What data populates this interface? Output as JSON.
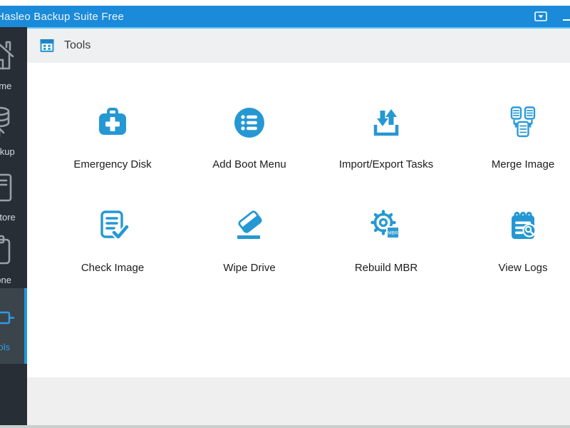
{
  "titlebar": {
    "title": "Hasleo Backup Suite Free"
  },
  "header": {
    "title": "Tools"
  },
  "sidebar": {
    "items": [
      {
        "label": "Home",
        "selected": false
      },
      {
        "label": "Backup",
        "selected": false
      },
      {
        "label": "Restore",
        "selected": false
      },
      {
        "label": "Clone",
        "selected": false
      },
      {
        "label": "Tools",
        "selected": true
      }
    ]
  },
  "tools": [
    {
      "label": "Emergency Disk"
    },
    {
      "label": "Add Boot Menu"
    },
    {
      "label": "Import/Export Tasks"
    },
    {
      "label": "Merge Image"
    },
    {
      "label": "Check Image"
    },
    {
      "label": "Wipe Drive"
    },
    {
      "label": "Rebuild MBR"
    },
    {
      "label": "View Logs"
    }
  ],
  "icons": {
    "mbr_badge": "MBR"
  },
  "colors": {
    "accent_blue": "#2598d3",
    "titlebar_blue": "#1a8ad9",
    "accent_line": "#55c4f2",
    "sidebar_bg": "#272e36",
    "sidebar_selected_bg": "#3b434b",
    "selected_stripe": "#2196e3",
    "header_bg": "#eef0f2",
    "footer_bg": "#efefef"
  }
}
